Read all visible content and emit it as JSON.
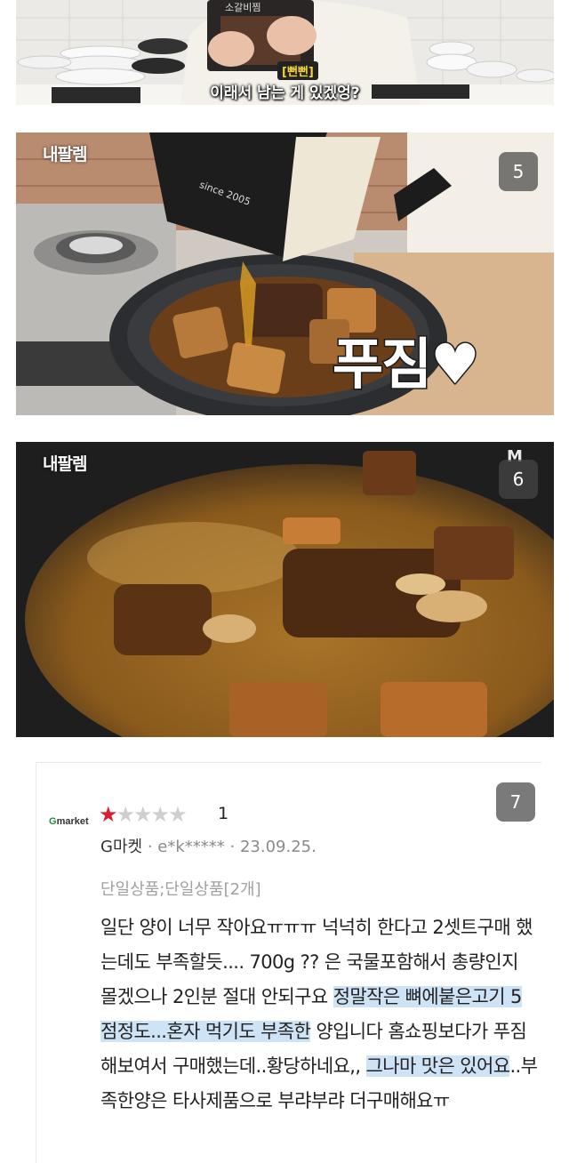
{
  "panel1": {
    "sfx": "[뻔뻔]",
    "subtitle": "이래서 남는 게 있겠엉?",
    "package_text": "소갈비찜"
  },
  "panel2": {
    "watermark": "내팔렘",
    "badge": "5",
    "caption": "푸짐♥",
    "pouch_text": "since 2005"
  },
  "panel3": {
    "watermark": "내팔렘",
    "badge": "6",
    "logo": "M"
  },
  "review": {
    "badge": "7",
    "logo_g": "G",
    "logo_rest": "market",
    "stars_filled": 1,
    "stars_total": 5,
    "rating": "1",
    "store": "G마켓",
    "user": "e*k*****",
    "date": "23.09.25.",
    "option": "단일상품;단일상품[2개]",
    "text_1": "일단 양이 너무 작아요ㅠㅠㅠ 넉넉히 한다고 2셋트구매 했는데도 부족할듯.... 700g ?? 은 국물포함해서 총량인지 몰겠으나 2인분 절대 안되구요 ",
    "highlight_1": "정말작은 뼈에붙은고기 5점정도...혼자 먹기도 부족한",
    "text_2": " 양입니다 홈쇼핑보다가 푸짐해보여서 구매했는데..황당하네요,, ",
    "highlight_2": "그나마 맛은 있어요",
    "text_3": "..부족한양은 타사제품으로 부랴부랴 더구매해요ㅠ"
  },
  "colors": {
    "star": "#d8202d",
    "highlight": "#cfe3f6",
    "gmarket_green": "#2a8a3a"
  }
}
